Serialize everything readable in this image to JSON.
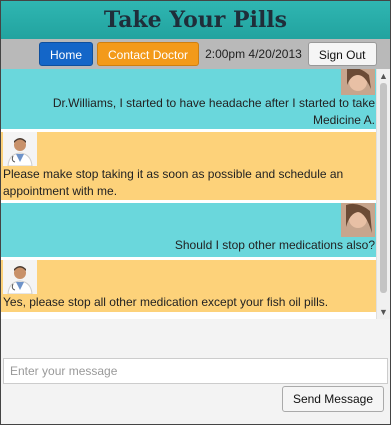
{
  "app": {
    "title": "Take Your Pills"
  },
  "nav": {
    "home_label": "Home",
    "contact_label": "Contact Doctor",
    "datetime": "2:00pm 4/20/2013",
    "signout_label": "Sign Out"
  },
  "messages": [
    {
      "sender": "patient",
      "avatar": "patient-photo",
      "text": "Dr.Williams, I started to have headache after I started to take Medicine A."
    },
    {
      "sender": "doctor",
      "avatar": "doctor-photo",
      "text": "Please make stop taking it as soon as possible and schedule an appointment with me."
    },
    {
      "sender": "patient",
      "avatar": "patient-photo",
      "text": "Should I stop other medications also?"
    },
    {
      "sender": "doctor",
      "avatar": "doctor-photo",
      "text": "Yes, please stop all other medication except your fish oil pills."
    }
  ],
  "composer": {
    "placeholder": "Enter your message",
    "value": "",
    "send_label": "Send Message"
  },
  "colors": {
    "header": "#2fb6b2",
    "patient_bubble": "#6ad7dc",
    "doctor_bubble": "#fdd27a",
    "home_button": "#1466c8",
    "contact_button": "#f39a1a"
  }
}
